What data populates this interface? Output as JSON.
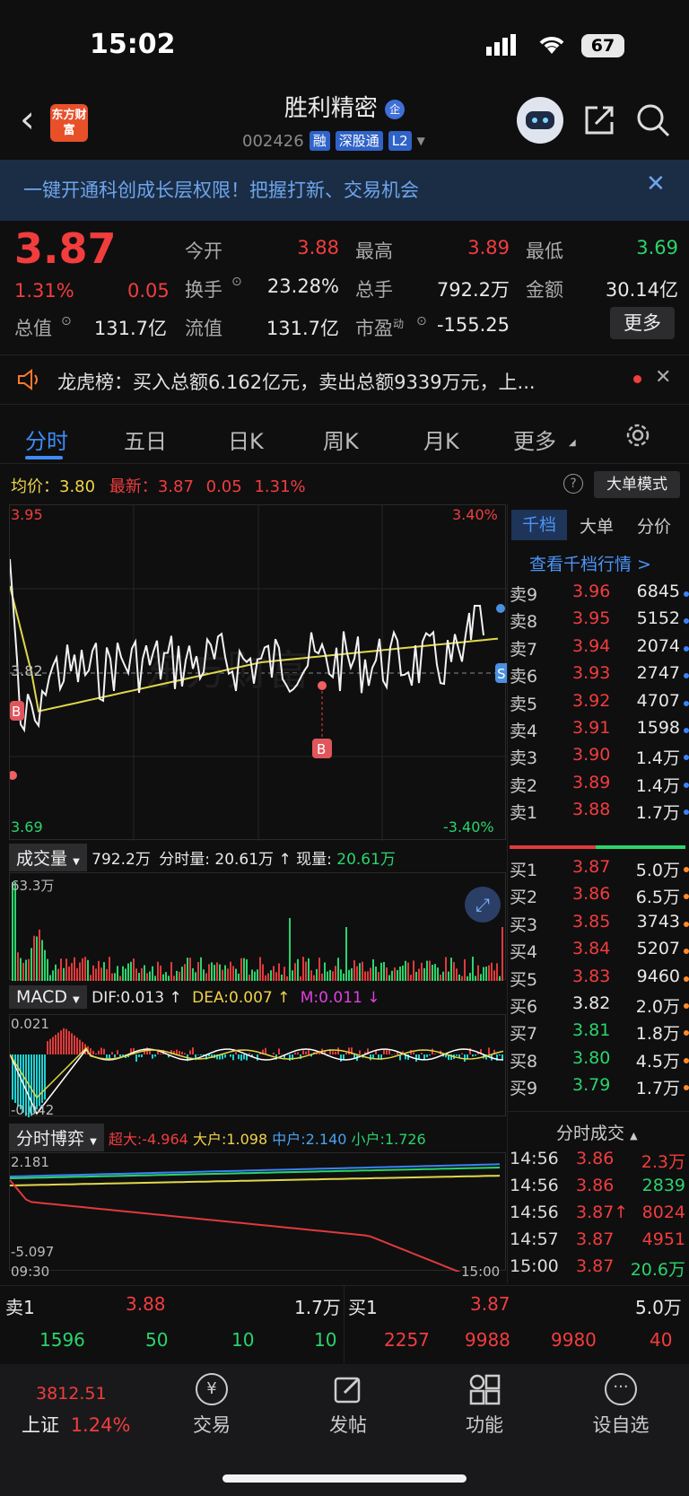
{
  "status": {
    "time": "15:02",
    "battery": "67"
  },
  "header": {
    "app_logo": "东方财富",
    "name": "胜利精密",
    "name_badge": "企",
    "code": "002426",
    "tags": [
      "融",
      "深股通",
      "L2"
    ]
  },
  "banner": {
    "text": "一键开通科创成长层权限！把握打新、交易机会"
  },
  "quote": {
    "price": "3.87",
    "pct": "1.31%",
    "chg": "0.05",
    "labels": {
      "open": "今开",
      "high": "最高",
      "low": "最低",
      "turnover": "换手",
      "volume": "总手",
      "amount": "金额",
      "mcap": "总值",
      "float": "流值",
      "pe": "市盈",
      "pe_sup": "动"
    },
    "open": "3.88",
    "high": "3.89",
    "low": "3.69",
    "turnover": "23.28%",
    "volume": "792.2万",
    "amount": "30.14亿",
    "mcap": "131.7亿",
    "float": "131.7亿",
    "pe": "-155.25",
    "more": "更多"
  },
  "news": {
    "text": "龙虎榜：买入总额6.162亿元，卖出总额9339万元，上..."
  },
  "tabs": [
    "分时",
    "五日",
    "日K",
    "周K",
    "月K",
    "更多"
  ],
  "chart_header": {
    "avg_label": "均价：",
    "avg": "3.80",
    "latest_label": "最新：",
    "latest": "3.87",
    "chg": "0.05",
    "pct": "1.31%",
    "mode_btn": "大单模式"
  },
  "chart_data": [
    {
      "type": "line",
      "name": "分时",
      "y_max": "3.95",
      "y_min": "3.69",
      "y_ref": "3.82",
      "pct_max": "3.40%",
      "pct_min": "-3.40%",
      "markers": [
        "B",
        "S"
      ],
      "watermark": "东方财富",
      "series": [
        {
          "color": "#ffffff"
        },
        {
          "color": "#e0d84a"
        }
      ]
    },
    {
      "type": "bar",
      "name": "成交量",
      "max_label": "63.3万",
      "total": "792.2万",
      "fen_label": "分时量: ",
      "fen": "20.61万",
      "now_label": "现量: ",
      "now": "20.61万"
    },
    {
      "type": "bar",
      "name": "MACD",
      "dif": "DIF:0.013 ↑",
      "dea": "DEA:0.007 ↑",
      "m": "M:0.011 ↓",
      "top": "0.021",
      "bottom": "-0.042"
    },
    {
      "type": "line",
      "name": "分时博弈",
      "super": "超大:-4.964",
      "large": "大户:1.098",
      "mid": "中户:2.140",
      "small": "小户:1.726",
      "top": "2.181",
      "bottom": "-5.097",
      "x_start": "09:30",
      "x_end": "15:00"
    }
  ],
  "orderbook": {
    "tabs": [
      "千档",
      "大单",
      "分价"
    ],
    "link": "查看千档行情 >",
    "asks": [
      {
        "l": "卖9",
        "p": "3.96",
        "v": "6845",
        "d": "blue"
      },
      {
        "l": "卖8",
        "p": "3.95",
        "v": "5152",
        "d": "blue"
      },
      {
        "l": "卖7",
        "p": "3.94",
        "v": "2074",
        "d": "blue"
      },
      {
        "l": "卖6",
        "p": "3.93",
        "v": "2747",
        "d": "blue"
      },
      {
        "l": "卖5",
        "p": "3.92",
        "v": "4707",
        "d": "blue"
      },
      {
        "l": "卖4",
        "p": "3.91",
        "v": "1598",
        "d": "blue"
      },
      {
        "l": "卖3",
        "p": "3.90",
        "v": "1.4万",
        "d": "blue"
      },
      {
        "l": "卖2",
        "p": "3.89",
        "v": "1.4万",
        "d": "blue"
      },
      {
        "l": "卖1",
        "p": "3.88",
        "v": "1.7万",
        "d": "blue"
      }
    ],
    "bids": [
      {
        "l": "买1",
        "p": "3.87",
        "v": "5.0万",
        "d": "orange",
        "c": "red"
      },
      {
        "l": "买2",
        "p": "3.86",
        "v": "6.5万",
        "d": "orange",
        "c": "red"
      },
      {
        "l": "买3",
        "p": "3.85",
        "v": "3743",
        "d": "orange",
        "c": "red"
      },
      {
        "l": "买4",
        "p": "3.84",
        "v": "5207",
        "d": "orange",
        "c": "red"
      },
      {
        "l": "买5",
        "p": "3.83",
        "v": "9460",
        "d": "orange",
        "c": "red"
      },
      {
        "l": "买6",
        "p": "3.82",
        "v": "2.0万",
        "d": "orange",
        "c": "white"
      },
      {
        "l": "买7",
        "p": "3.81",
        "v": "1.8万",
        "d": "orange",
        "c": "green"
      },
      {
        "l": "买8",
        "p": "3.80",
        "v": "4.5万",
        "d": "orange",
        "c": "green"
      },
      {
        "l": "买9",
        "p": "3.79",
        "v": "1.7万",
        "d": "orange",
        "c": "green"
      }
    ],
    "ticks_title": "分时成交",
    "ticks": [
      {
        "t": "14:56",
        "p": "3.86",
        "v": "2.3万",
        "vc": "red"
      },
      {
        "t": "14:56",
        "p": "3.86",
        "v": "2839",
        "vc": "green"
      },
      {
        "t": "14:56",
        "p": "3.87↑",
        "v": "8024",
        "vc": "red"
      },
      {
        "t": "14:57",
        "p": "3.87",
        "v": "4951",
        "vc": "red"
      },
      {
        "t": "15:00",
        "p": "3.87",
        "v": "20.6万",
        "vc": "green"
      }
    ]
  },
  "queue": {
    "ask_label": "卖1",
    "ask_price": "3.88",
    "ask_vol": "1.7万",
    "bid_label": "买1",
    "bid_price": "3.87",
    "bid_vol": "5.0万",
    "ask_orders": [
      "1596",
      "50",
      "10",
      "10"
    ],
    "bid_orders": [
      "2257",
      "9988",
      "9980",
      "40"
    ]
  },
  "bottom_nav": {
    "index_value": "3812.51",
    "index_name": "上证",
    "index_pct": "1.24%",
    "items": [
      "交易",
      "发帖",
      "功能",
      "设自选"
    ]
  }
}
